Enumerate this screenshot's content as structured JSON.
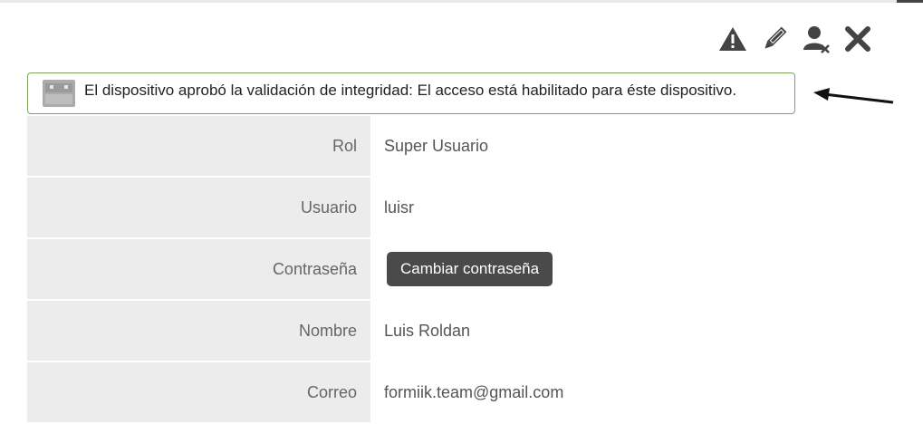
{
  "toolbar": {
    "icons": [
      "warning-icon",
      "edit-pencil-icon",
      "remove-user-icon",
      "close-icon"
    ]
  },
  "notice": {
    "text": "El dispositivo aprobó la validación de integridad: El acceso está habilitado para éste dispositivo.",
    "icon": "android-device-icon",
    "border_color": "#7ea35a"
  },
  "form": {
    "rows": [
      {
        "label": "Rol",
        "value": "Super Usuario"
      },
      {
        "label": "Usuario",
        "value": "luisr"
      },
      {
        "label": "Contraseña",
        "button": "Cambiar contraseña"
      },
      {
        "label": "Nombre",
        "value": "Luis Roldan"
      },
      {
        "label": "Correo",
        "value": "formiik.team@gmail.com"
      }
    ]
  }
}
